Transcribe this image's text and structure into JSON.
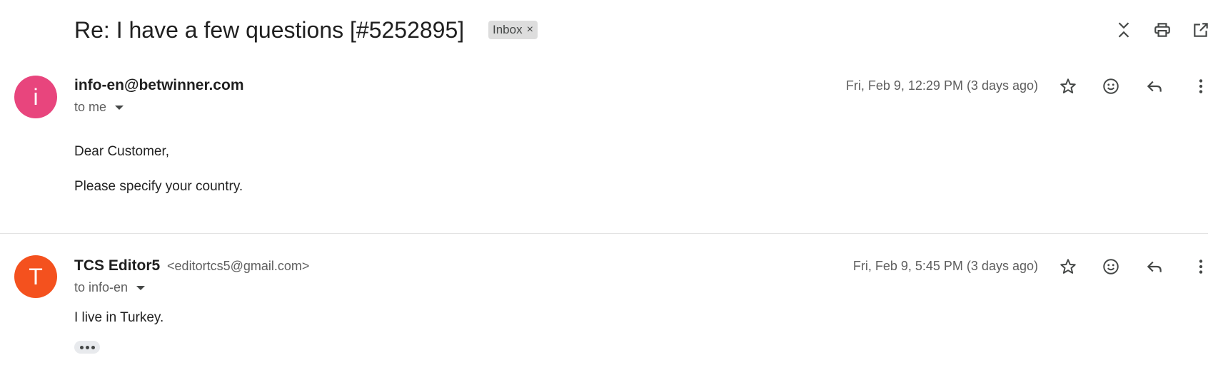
{
  "thread": {
    "subject": "Re: I have a few questions [#5252895]",
    "label_chip": "Inbox",
    "label_remove": "×"
  },
  "top_actions": {
    "collapse": "collapse-all-icon",
    "print": "print-icon",
    "popout": "open-in-new-window-icon"
  },
  "messages": [
    {
      "avatar_letter": "i",
      "avatar_color": "#e8457d",
      "sender_name": "info-en@betwinner.com",
      "sender_email": "",
      "recipient": "to me",
      "timestamp": "Fri, Feb 9, 12:29 PM (3 days ago)",
      "body": [
        "Dear Customer,",
        "Please specify your country."
      ]
    },
    {
      "avatar_letter": "T",
      "avatar_color": "#f4511e",
      "sender_name": "TCS Editor5",
      "sender_email": "<editortcs5@gmail.com>",
      "recipient": "to info-en",
      "timestamp": "Fri, Feb 9, 5:45 PM (3 days ago)",
      "body": [
        "I live in Turkey."
      ]
    }
  ],
  "message_actions": [
    "star-icon",
    "emoji-reaction-icon",
    "reply-icon",
    "more-vert-icon"
  ]
}
